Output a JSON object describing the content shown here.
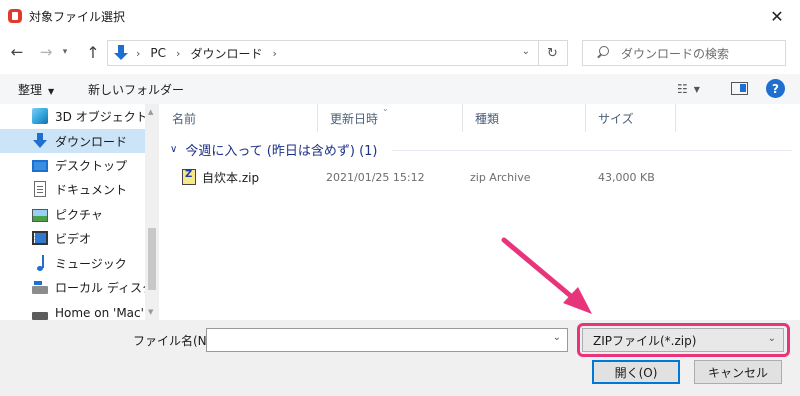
{
  "window": {
    "title": "対象ファイル選択",
    "close_glyph": "✕"
  },
  "address": {
    "crumbs": [
      "PC",
      "ダウンロード"
    ],
    "search_placeholder": "ダウンロードの検索"
  },
  "toolbar": {
    "organize_label": "整理",
    "new_folder_label": "新しいフォルダー"
  },
  "sidebar": {
    "items": [
      {
        "label": "3D オブジェクト",
        "icon": "cube-3d-icon"
      },
      {
        "label": "ダウンロード",
        "icon": "download-arrow-icon",
        "selected": true
      },
      {
        "label": "デスクトップ",
        "icon": "desktop-icon"
      },
      {
        "label": "ドキュメント",
        "icon": "document-icon"
      },
      {
        "label": "ピクチャ",
        "icon": "pictures-icon"
      },
      {
        "label": "ビデオ",
        "icon": "video-icon"
      },
      {
        "label": "ミュージック",
        "icon": "music-note-icon"
      },
      {
        "label": "ローカル ディスク (C",
        "icon": "local-disk-icon"
      },
      {
        "label": "Home on 'Mac' (",
        "icon": "network-drive-icon"
      }
    ]
  },
  "file_list": {
    "columns": [
      "名前",
      "更新日時",
      "種類",
      "サイズ"
    ],
    "group_label": "今週に入って (昨日は含めず) (1)",
    "files": [
      {
        "name": "自炊本.zip",
        "modified": "2021/01/25 15:12",
        "type": "zip Archive",
        "size": "43,000 KB",
        "icon": "zip-file-icon"
      }
    ]
  },
  "bottom": {
    "filename_label": "ファイル名(N):",
    "filename_value": "",
    "filetype_value": "ZIPファイル(*.zip)",
    "open_button": "開く(O)",
    "cancel_button": "キャンセル"
  },
  "colors": {
    "accent": "#0078d7",
    "selection": "#cce4f7",
    "annotation": "#e8347a"
  }
}
